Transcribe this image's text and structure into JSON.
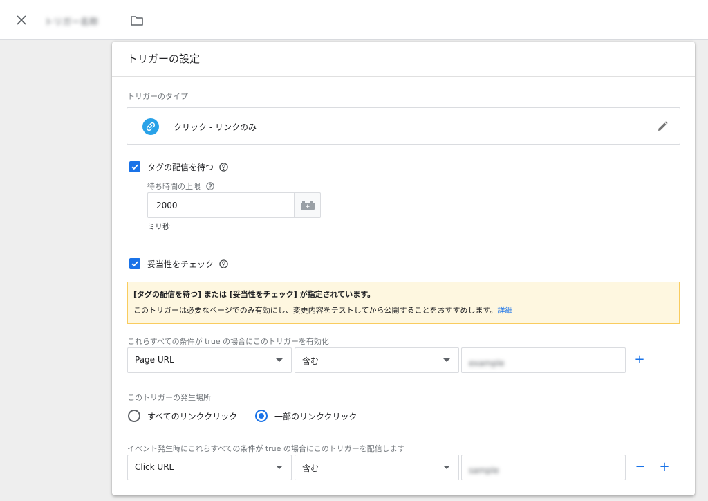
{
  "topbar": {
    "trigger_name": "トリガー名称"
  },
  "panel": {
    "title": "トリガーの設定",
    "trigger_type": {
      "label": "トリガーのタイプ",
      "value": "クリック - リンクのみ"
    },
    "wait_for_tags": {
      "label": "タグの配信を待つ",
      "checked": true,
      "max_wait_label": "待ち時間の上限",
      "max_wait_value": "2000",
      "unit": "ミリ秒"
    },
    "check_validation": {
      "label": "妥当性をチェック",
      "checked": true
    },
    "warning": {
      "title": "[タグの配信を待つ] または [妥当性をチェック] が指定されています。",
      "body": "このトリガーは必要なページでのみ有効にし、変更内容をテストしてから公開することをおすすめします。",
      "link": "詳細"
    },
    "enable_conditions": {
      "label": "これらすべての条件が true の場合にこのトリガーを有効化",
      "variable": "Page URL",
      "operator": "含む",
      "value": "example"
    },
    "fires_on": {
      "label": "このトリガーの発生場所",
      "options": [
        {
          "label": "すべてのリンククリック",
          "selected": false
        },
        {
          "label": "一部のリンククリック",
          "selected": true
        }
      ]
    },
    "fire_conditions": {
      "label": "イベント発生時にこれらすべての条件が true の場合にこのトリガーを配信します",
      "variable": "Click URL",
      "operator": "含む",
      "value": "sample"
    },
    "add_symbol": "+",
    "remove_symbol": "−"
  },
  "colors": {
    "accent": "#1a73e8",
    "type_icon": "#29a2e8",
    "warning_bg": "#fef7e0",
    "warning_border": "#f9cc5f"
  }
}
